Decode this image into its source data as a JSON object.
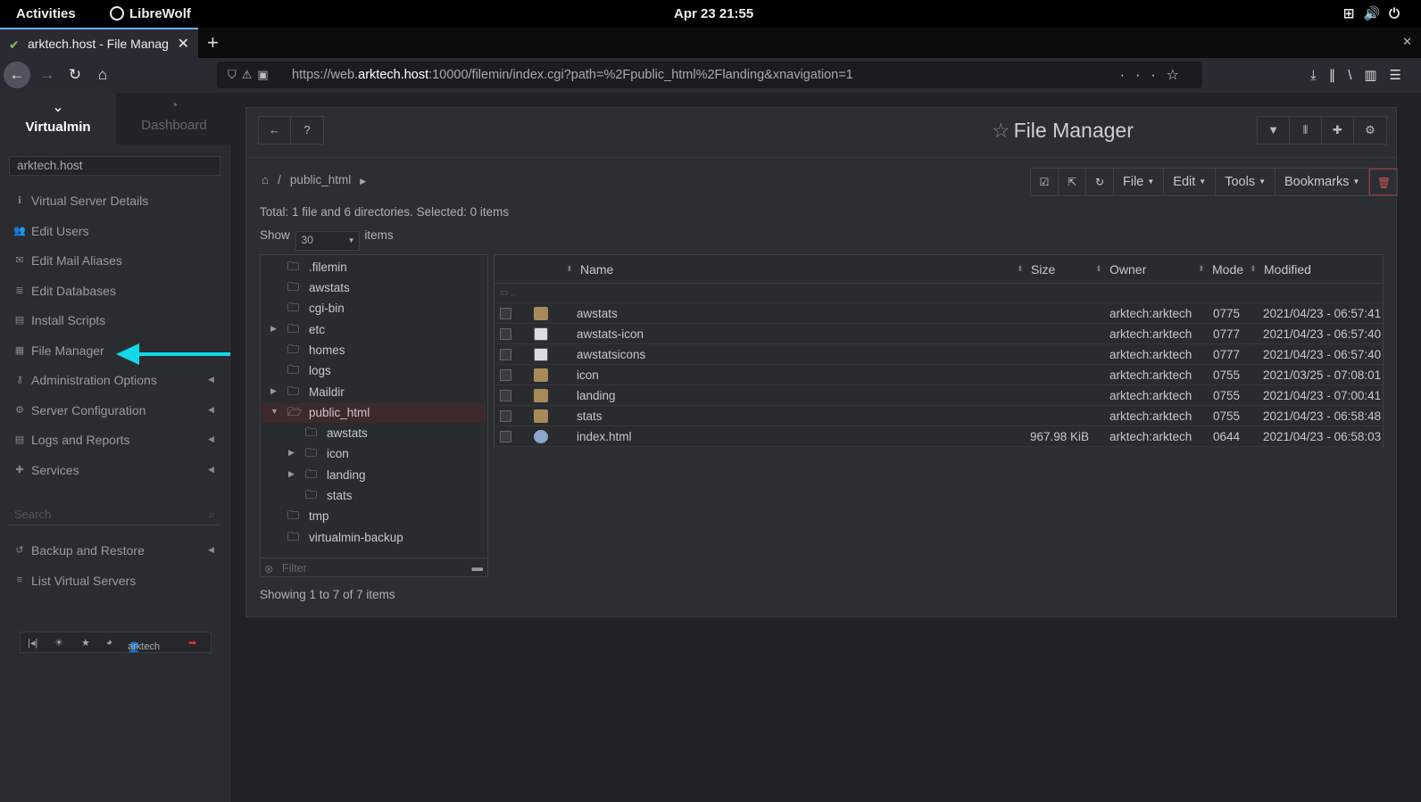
{
  "os": {
    "activities": "Activities",
    "app": "LibreWolf",
    "clock": "Apr 23  21:55"
  },
  "browser": {
    "tab_title": "arktech.host - File Manag",
    "url_prefix": "https://web.",
    "url_host": "arktech.host",
    "url_rest": ":10000/filemin/index.cgi?path=%2Fpublic_html%2Flanding&xnavigation=1"
  },
  "sidebar": {
    "tab_virtualmin": "Virtualmin",
    "tab_dashboard": "Dashboard",
    "domain": "arktech.host",
    "items": [
      {
        "label": "Virtual Server Details",
        "icon": "info-icon"
      },
      {
        "label": "Edit Users",
        "icon": "users-icon"
      },
      {
        "label": "Edit Mail Aliases",
        "icon": "mail-icon"
      },
      {
        "label": "Edit Databases",
        "icon": "database-icon"
      },
      {
        "label": "Install Scripts",
        "icon": "terminal-icon"
      },
      {
        "label": "File Manager",
        "icon": "folder-icon"
      },
      {
        "label": "Administration Options",
        "icon": "key-icon"
      },
      {
        "label": "Server Configuration",
        "icon": "cogs-icon"
      },
      {
        "label": "Logs and Reports",
        "icon": "file-icon"
      },
      {
        "label": "Services",
        "icon": "puzzle-icon"
      },
      {
        "label": "Backup and Restore",
        "icon": "history-icon"
      },
      {
        "label": "List Virtual Servers",
        "icon": "list-icon"
      }
    ],
    "search_placeholder": "Search",
    "user": "arktech",
    "annotation_color": "#12d8e8"
  },
  "panel": {
    "title": "File Manager",
    "breadcrumb": [
      "public_html"
    ],
    "toolbar": {
      "file": "File",
      "edit": "Edit",
      "tools": "Tools",
      "bookmarks": "Bookmarks"
    },
    "total": "Total: 1 file and 6 directories. Selected: 0 items",
    "show_label": "Show",
    "show_value": "30",
    "items_label": "items",
    "filter_placeholder": "Filter",
    "footer": "Showing 1 to 7 of 7 items"
  },
  "tree": [
    {
      "name": ".filemin"
    },
    {
      "name": "awstats"
    },
    {
      "name": "cgi-bin"
    },
    {
      "name": "etc"
    },
    {
      "name": "homes"
    },
    {
      "name": "logs"
    },
    {
      "name": "Maildir"
    },
    {
      "name": "public_html"
    },
    {
      "name": "awstats"
    },
    {
      "name": "icon"
    },
    {
      "name": "landing"
    },
    {
      "name": "stats"
    },
    {
      "name": "tmp"
    },
    {
      "name": "virtualmin-backup"
    }
  ],
  "columns": {
    "name": "Name",
    "size": "Size",
    "owner": "Owner",
    "mode": "Mode",
    "modified": "Modified"
  },
  "updir": "..",
  "files": [
    {
      "name": "awstats",
      "size": "",
      "owner": "arktech:arktech",
      "mode": "0775",
      "modified": "2021/04/23 - 06:57:41",
      "type": "folder"
    },
    {
      "name": "awstats-icon",
      "size": "",
      "owner": "arktech:arktech",
      "mode": "0777",
      "modified": "2021/04/23 - 06:57:40",
      "type": "link"
    },
    {
      "name": "awstatsicons",
      "size": "",
      "owner": "arktech:arktech",
      "mode": "0777",
      "modified": "2021/04/23 - 06:57:40",
      "type": "link"
    },
    {
      "name": "icon",
      "size": "",
      "owner": "arktech:arktech",
      "mode": "0755",
      "modified": "2021/03/25 - 07:08:01",
      "type": "folder"
    },
    {
      "name": "landing",
      "size": "",
      "owner": "arktech:arktech",
      "mode": "0755",
      "modified": "2021/04/23 - 07:00:41",
      "type": "folder"
    },
    {
      "name": "stats",
      "size": "",
      "owner": "arktech:arktech",
      "mode": "0755",
      "modified": "2021/04/23 - 06:58:48",
      "type": "folder"
    },
    {
      "name": "index.html",
      "size": "967.98 KiB",
      "owner": "arktech:arktech",
      "mode": "0644",
      "modified": "2021/04/23 - 06:58:03",
      "type": "html"
    }
  ]
}
